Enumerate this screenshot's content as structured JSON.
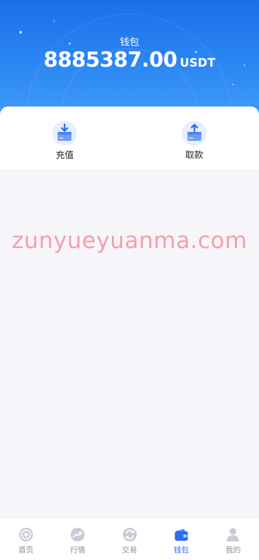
{
  "wallet": {
    "title": "钱包",
    "balance": "8885387.00",
    "unit": "USDT"
  },
  "actions": [
    {
      "label": "充值",
      "icon": "deposit-icon"
    },
    {
      "label": "取款",
      "icon": "withdraw-icon"
    }
  ],
  "watermark": "zunyueyuanma.com",
  "tabbar": {
    "items": [
      {
        "label": "首页",
        "icon": "home-icon",
        "active": false
      },
      {
        "label": "行情",
        "icon": "market-icon",
        "active": false
      },
      {
        "label": "交易",
        "icon": "trade-icon",
        "active": false
      },
      {
        "label": "钱包",
        "icon": "wallet-icon",
        "active": true
      },
      {
        "label": "我的",
        "icon": "profile-icon",
        "active": false
      }
    ]
  },
  "colors": {
    "header_top": "#1a6fe8",
    "header_bottom": "#4aa3fb",
    "accent": "#2a6df0",
    "tab_inactive": "#8a8f99",
    "watermark": "#f4a0ab",
    "page_bg": "#f6f6fa"
  }
}
